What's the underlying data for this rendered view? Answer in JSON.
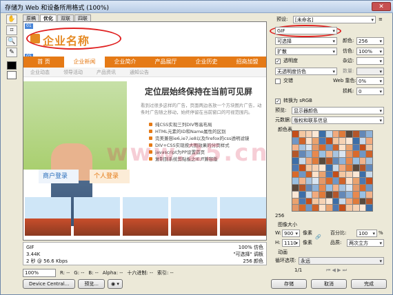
{
  "window": {
    "title": "存储为 Web 和设备所用格式 (100%)"
  },
  "tabs": [
    "原稿",
    "优化",
    "双联",
    "四联"
  ],
  "page": {
    "logo": "企业名称",
    "nav": [
      "首 页",
      "企业新闻",
      "企业简介",
      "产品展厅",
      "企业历史",
      "招商加盟"
    ],
    "subnav": [
      "企业动态",
      "领导活动",
      "产品资讯",
      "通知公告"
    ],
    "headline": "定位层始终保持在当前可见屏",
    "lead": "看到过很多这样的广告，页面两边各放一个方块图片广告，动条时广告随之移动，始终停留在当前窗口的可视范围内。",
    "list": [
      "纯CSS实现三列DIV等高布局",
      "HTML元素的ID和Name属性的区别",
      "完美兼容ie6,ie7,ie8以及firefox的css透明滤镜",
      "DIV+CSS实现按大图效果的分页样式",
      "javascript为PP设置首页",
      "复制到系统剪贴板之IE,ff兼容版"
    ],
    "login1": "商户登录",
    "login2": "个人登录",
    "watermark": "www.25.cn"
  },
  "status": {
    "format": "GIF",
    "size": "3.44K",
    "time": "2 秒 @ 56.6 Kbps",
    "dither": "100% 仿色",
    "palette": "\"可选择\" 调板",
    "colors": "256 颜色"
  },
  "bottom": {
    "zoom": "100%",
    "r": "R: --",
    "g": "G: --",
    "b": "B: --",
    "alpha": "Alpha: --",
    "hex": "十六进制: --",
    "index": "索引: --"
  },
  "buttons": {
    "device_central": "Device Central...",
    "preview": "预览...",
    "save": "存储",
    "cancel": "取消",
    "done": "完成"
  },
  "side": {
    "preset_label": "预设:",
    "preset_value": "[未命名]",
    "format": "GIF",
    "reduction": "可选择",
    "colors_label": "颜色:",
    "colors_value": "256",
    "dither_method": "扩散",
    "dither_label": "仿色:",
    "dither_value": "100%",
    "transparency": "透明度",
    "matte_label": "杂边:",
    "transparency_dither": "无透明度仿色",
    "amount_label": "数量:",
    "interlaced": "交错",
    "web_snap_label": "Web 靠色:",
    "web_snap_value": "0%",
    "lossy_label": "损耗:",
    "lossy_value": "0",
    "convert_srgb": "转换为 sRGB",
    "preview_label": "预览:",
    "preview_value": "显示器颜色",
    "metadata_label": "元数据:",
    "metadata_value": "版权和联系信息",
    "color_table_label": "颜色表",
    "color_count": "256",
    "image_size_label": "图像大小",
    "w_label": "W:",
    "w_value": "900",
    "h_label": "H:",
    "h_value": "1110",
    "px": "像素",
    "percent_label": "百分比:",
    "percent_value": "100",
    "percent_unit": "%",
    "quality_label": "品质:",
    "quality_value": "两次立方",
    "anim_label": "动画",
    "loop_label": "循环选项:",
    "loop_value": "永远",
    "frame": "1/1"
  },
  "palette_colors": [
    "#c44e1a",
    "#e07b3a",
    "#f2b38a",
    "#fde1c9",
    "#3c6ea8",
    "#8fb2d8",
    "#d96a2b",
    "#f4c7a1",
    "#5a4a3d",
    "#a8c4e0",
    "#eaa26e",
    "#c8d9ea",
    "#e8894e",
    "#7096c4",
    "#f6d2b4",
    "#b3562a",
    "#d9e5f1",
    "#4e78b0",
    "#f1aa7e",
    "#9ac0e2",
    "#cf6228",
    "#fbe7d5",
    "#6388b8",
    "#e49868"
  ]
}
